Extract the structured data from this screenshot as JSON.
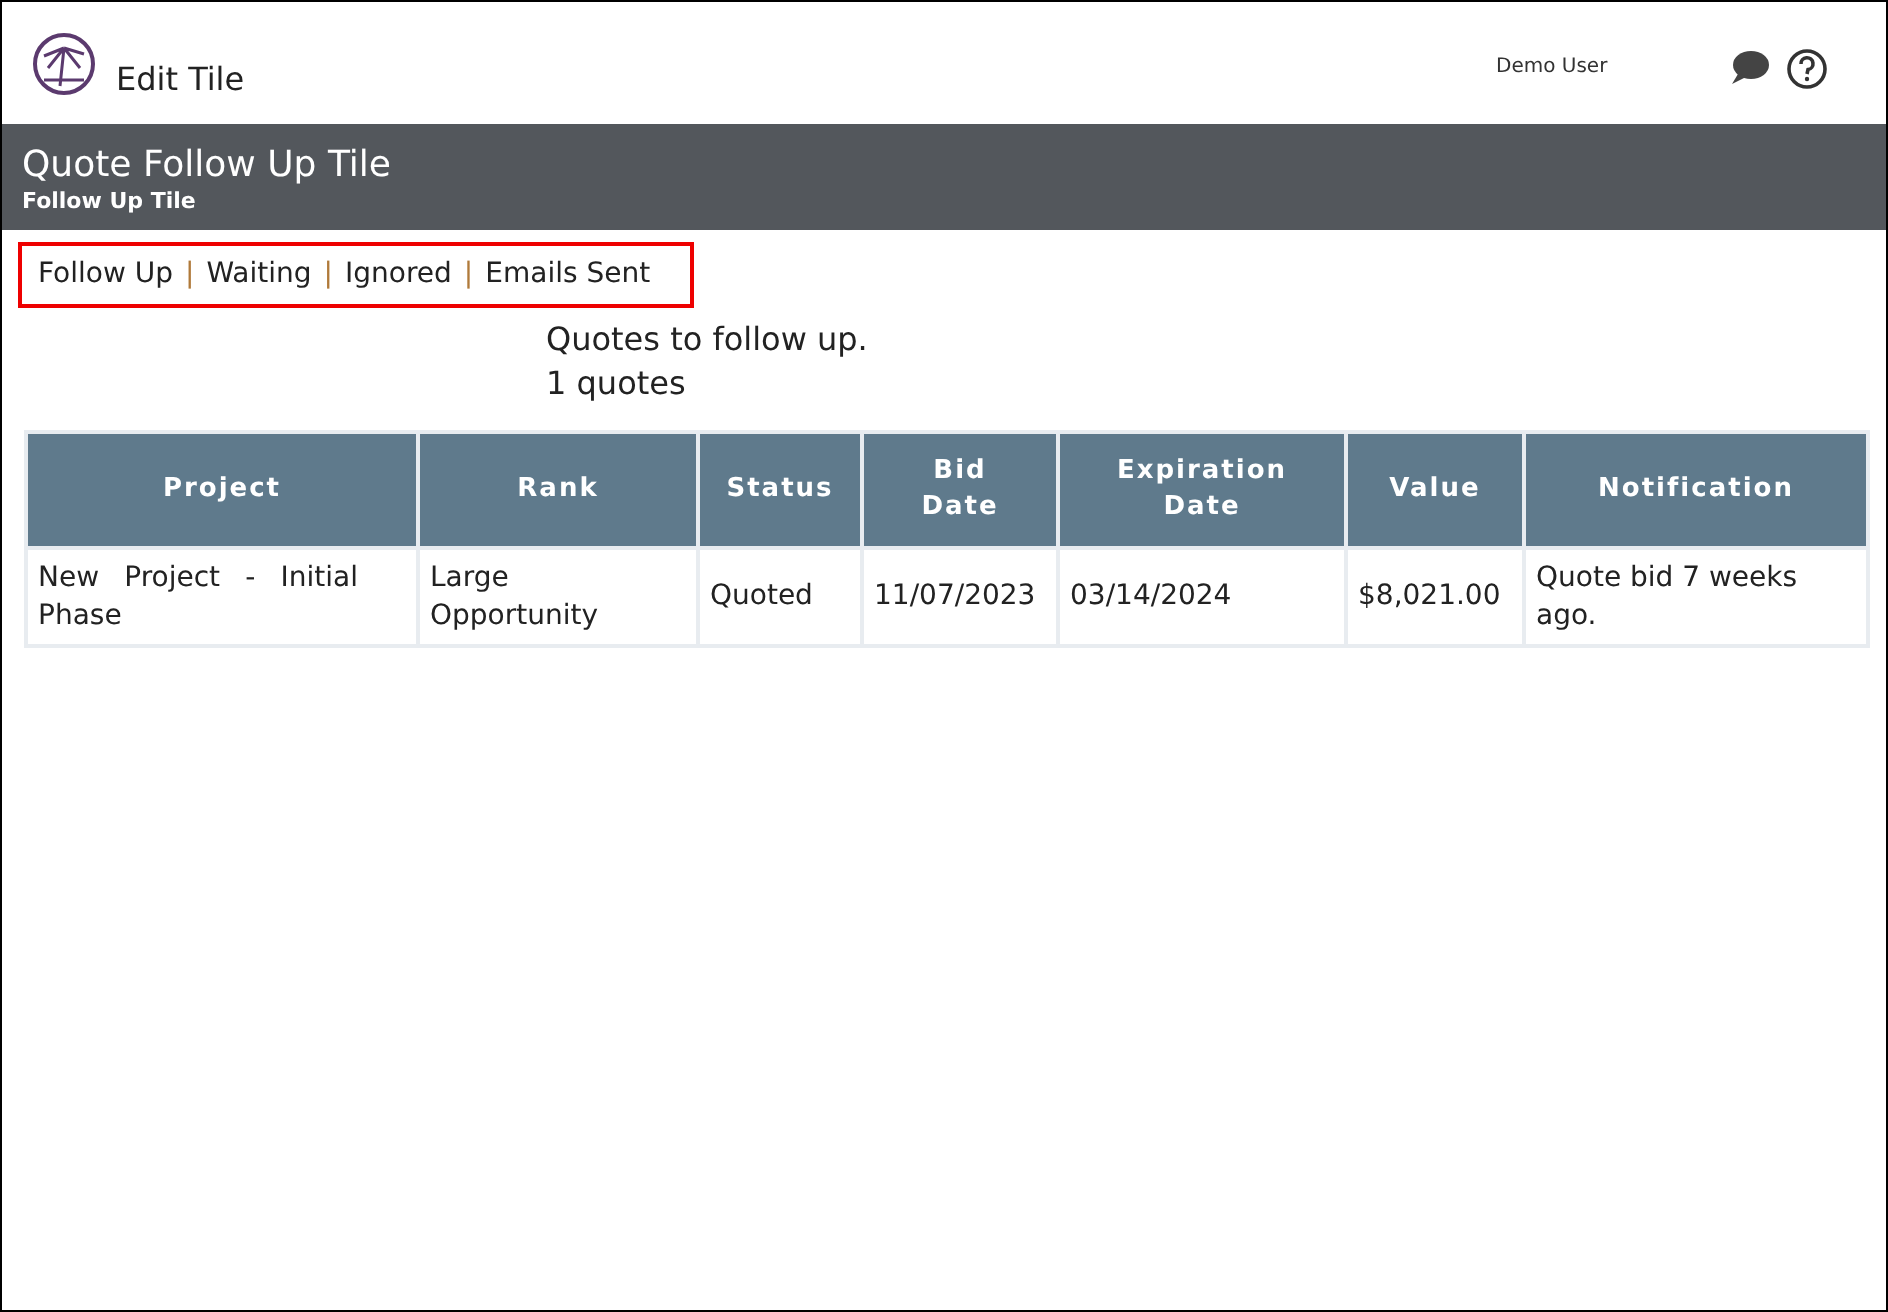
{
  "header": {
    "title": "Edit Tile",
    "user": "Demo User"
  },
  "banner": {
    "title": "Quote Follow Up Tile",
    "subtitle": "Follow Up Tile"
  },
  "tabs": [
    {
      "label": "Follow Up"
    },
    {
      "label": "Waiting"
    },
    {
      "label": "Ignored"
    },
    {
      "label": "Emails Sent"
    }
  ],
  "tab_separators": [
    "|",
    "|",
    "|"
  ],
  "summary": [
    "Quotes to follow up.",
    "1 quotes"
  ],
  "table": {
    "columns": [
      "Project",
      "Rank",
      "Status",
      "Bid Date",
      "Expiration Date",
      "Value",
      "Notification"
    ],
    "rows": [
      {
        "cells": [
          "New Project - Initial Phase",
          "Large Opportunity",
          "Quoted",
          "11/07/2023",
          "03/14/2024",
          "$8,021.00",
          "Quote bid 7 weeks ago."
        ]
      }
    ]
  }
}
